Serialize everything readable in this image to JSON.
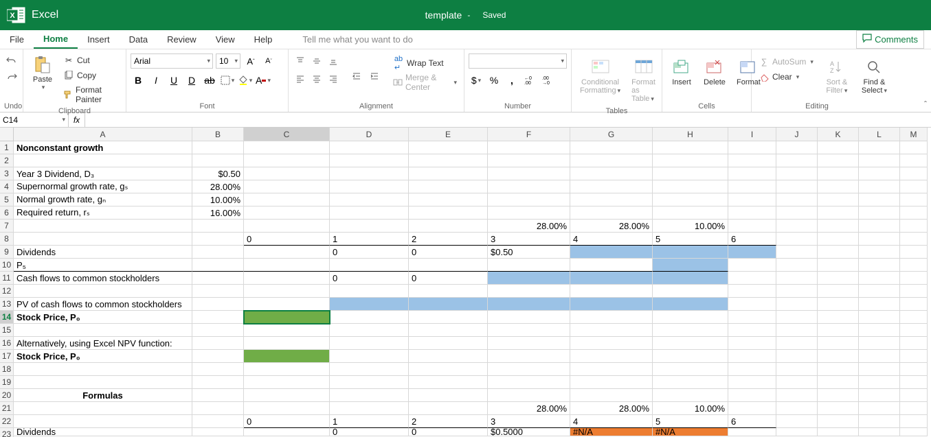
{
  "app": {
    "name": "Excel",
    "doc": "template",
    "sep": "-",
    "status": "Saved"
  },
  "menu": {
    "file": "File",
    "home": "Home",
    "insert": "Insert",
    "data": "Data",
    "review": "Review",
    "view": "View",
    "help": "Help",
    "tellme": "Tell me what you want to do",
    "comments": "Comments"
  },
  "ribbon": {
    "undo": "Undo",
    "clipboard": {
      "paste": "Paste",
      "cut": "Cut",
      "copy": "Copy",
      "formatpainter": "Format Painter",
      "label": "Clipboard"
    },
    "font": {
      "name": "Arial",
      "size": "10",
      "label": "Font"
    },
    "alignment": {
      "wrap": "Wrap Text",
      "merge": "Merge & Center",
      "label": "Alignment"
    },
    "number": {
      "label": "Number"
    },
    "tables": {
      "cond": "Conditional",
      "cond2": "Formatting",
      "fmt": "Format",
      "fmt2": "as Table",
      "label": "Tables"
    },
    "cells": {
      "insert": "Insert",
      "delete": "Delete",
      "format": "Format",
      "label": "Cells"
    },
    "editing": {
      "autosum": "AutoSum",
      "clear": "Clear",
      "sort": "Sort &",
      "sort2": "Filter",
      "find": "Find &",
      "find2": "Select",
      "label": "Editing"
    }
  },
  "namebox": "C14",
  "cols": {
    "A": 260,
    "B": 75,
    "C": 125,
    "D": 115,
    "E": 115,
    "F": 120,
    "G": 120,
    "H": 110,
    "I": 70,
    "J": 60,
    "K": 60,
    "L": 60,
    "M": 20
  },
  "sheet": {
    "r1": {
      "A": "Nonconstant growth"
    },
    "r3": {
      "A": "Year 3 Dividend, D₃",
      "B": "$0.50"
    },
    "r4": {
      "A": "Supernormal growth rate, gₛ",
      "B": "28.00%"
    },
    "r5": {
      "A": "Normal growth rate, gₙ",
      "B": "10.00%"
    },
    "r6": {
      "A": "Required return, rₛ",
      "B": "16.00%"
    },
    "r7": {
      "F": "28.00%",
      "G": "28.00%",
      "H": "10.00%"
    },
    "r8": {
      "C": "0",
      "D": "1",
      "E": "2",
      "F": "3",
      "G": "4",
      "H": "5",
      "I": "6"
    },
    "r9": {
      "A": "Dividends",
      "D": "0",
      "E": "0",
      "F": "$0.50"
    },
    "r10": {
      "A": "P₅"
    },
    "r11": {
      "A": "Cash flows to common stockholders",
      "D": "0",
      "E": "0"
    },
    "r13": {
      "A": "PV of cash flows to common stockholders"
    },
    "r14": {
      "A": "Stock Price, P₀"
    },
    "r16": {
      "A": "Alternatively, using Excel NPV function:"
    },
    "r17": {
      "A": "Stock Price, P₀"
    },
    "r20": {
      "A": "Formulas"
    },
    "r21": {
      "F": "28.00%",
      "G": "28.00%",
      "H": "10.00%"
    },
    "r22": {
      "C": "0",
      "D": "1",
      "E": "2",
      "F": "3",
      "G": "4",
      "H": "5",
      "I": "6"
    },
    "r23": {
      "A": "Dividends",
      "D": "0",
      "E": "0",
      "F": "$0.5000",
      "G": "#N/A",
      "H": "#N/A"
    }
  }
}
